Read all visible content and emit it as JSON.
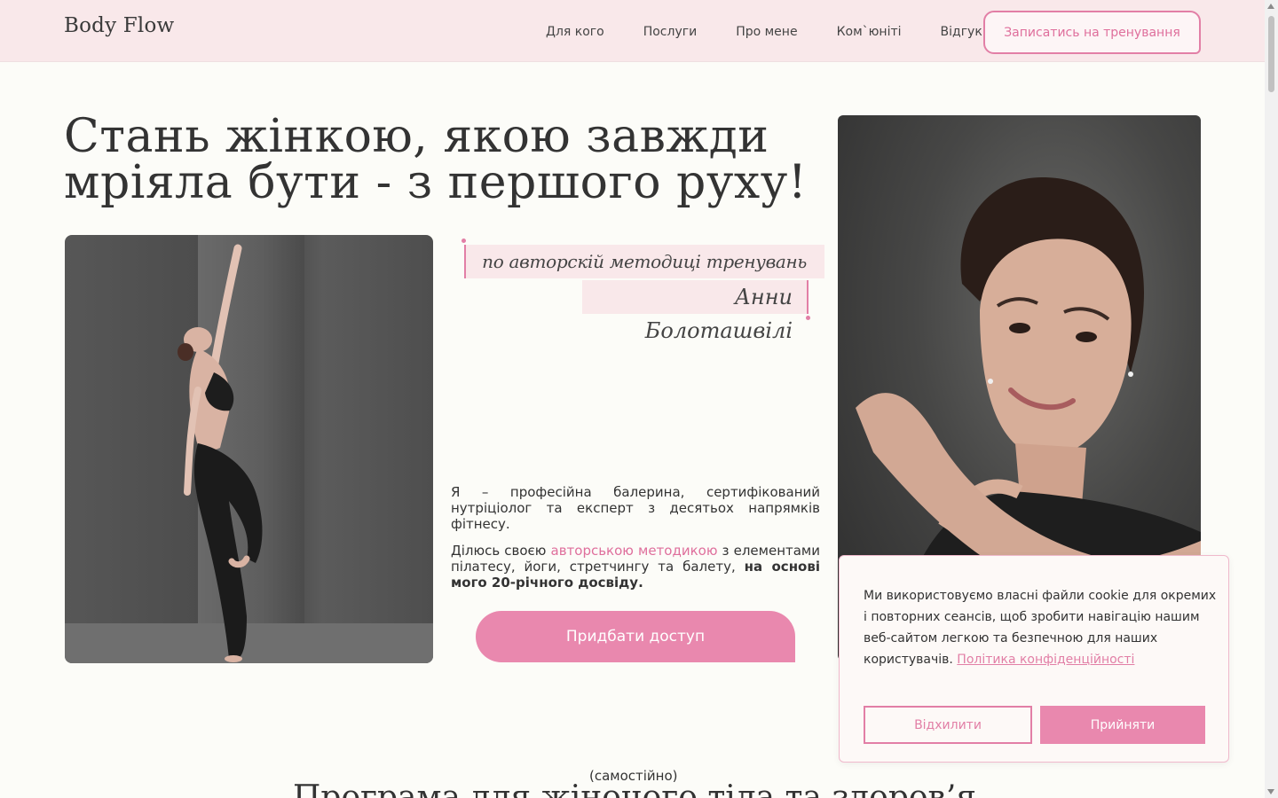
{
  "header": {
    "logo": "Body Flow",
    "nav": [
      "Для кого",
      "Послуги",
      "Про мене",
      "Ком`юніті",
      "Відгуки"
    ],
    "cta": "Записатись на тренування"
  },
  "hero": {
    "title_line1": "Стань жінкою, якою завжди",
    "title_line2": "мріяла бути - з першого руху!",
    "subtitle_line1": "по авторскій методиці тренувань",
    "subtitle_line2": "Анни Болоташвілі",
    "desc1": "Я – професійна балерина, сертифікований нутріціолог та експерт з десятьох напрямків фітнесу.",
    "desc2_before": "Ділюсь своєю ",
    "desc2_accent": "авторською методикою",
    "desc2_after": " з елементами пілатесу, йоги, стретчингу та балету,",
    "desc2_bold": "на основі мого 20-річного досвіду.",
    "buy_button": "Придбати доступ"
  },
  "next_section": {
    "small": "(самостійно)",
    "heading": "Програма для жіночого тіла та здоров’я"
  },
  "cookie": {
    "text": "Ми використовуємо власні файли cookie для окремих і повторних сеансів, щоб зробити навігацію нашим веб-сайтом легкою та безпечною для наших",
    "text_end": "користувачів.",
    "link": "Політика конфіденційності",
    "decline": "Відхилити",
    "accept": "Прийняти"
  },
  "colors": {
    "accent": "#e27fa6",
    "button": "#e988ae",
    "header_bg": "#f9e8ea",
    "page_bg": "#fcfcf8"
  }
}
